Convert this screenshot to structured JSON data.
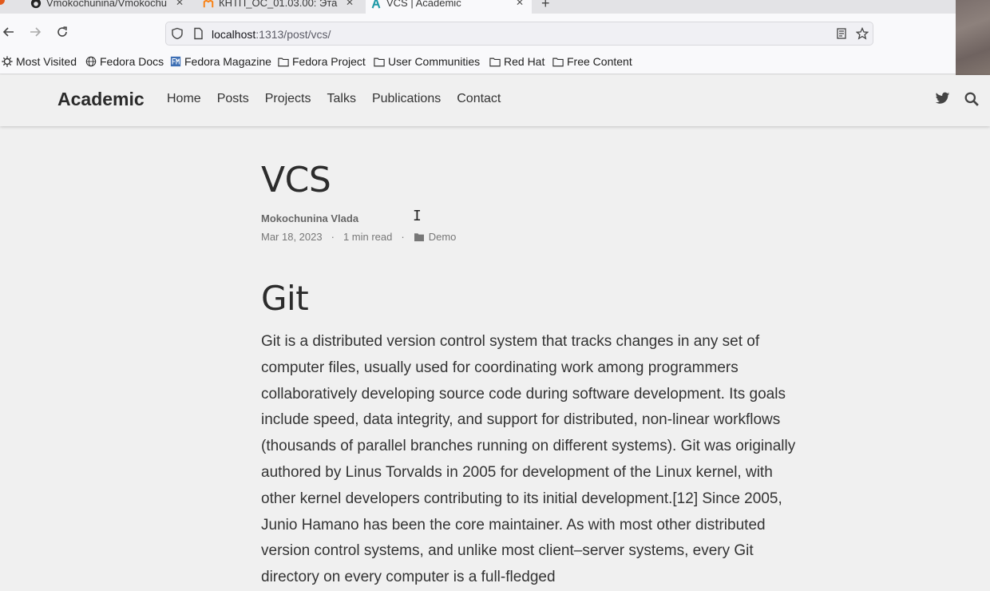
{
  "browser": {
    "tabs": [
      {
        "label": "Vmokochunina/Vmokochu",
        "icon": "github-icon",
        "active": false
      },
      {
        "label": "КНТП_ОС_01.03.00: Эта",
        "icon": "moodle-icon",
        "active": false
      },
      {
        "label": "VCS | Academic",
        "icon": "academic-icon",
        "active": true
      }
    ],
    "new_tab_label": "+",
    "url_host": "localhost",
    "url_path": ":1313/post/vcs/",
    "bookmarks": [
      {
        "label": "Most Visited",
        "icon": "gear-icon"
      },
      {
        "label": "Fedora Docs",
        "icon": "globe-icon"
      },
      {
        "label": "Fedora Magazine",
        "icon": "fedora-magazine-icon"
      },
      {
        "label": "Fedora Project",
        "icon": "folder-icon"
      },
      {
        "label": "User Communities",
        "icon": "folder-icon"
      },
      {
        "label": "Red Hat",
        "icon": "folder-icon"
      },
      {
        "label": "Free Content",
        "icon": "folder-icon"
      }
    ]
  },
  "site": {
    "brand": "Academic",
    "menu": [
      "Home",
      "Posts",
      "Projects",
      "Talks",
      "Publications",
      "Contact"
    ]
  },
  "article": {
    "title": "VCS",
    "author": "Mokochunina Vlada",
    "date": "Mar 18, 2023",
    "sep": "·",
    "read_time": "1 min read",
    "category": "Demo",
    "heading": "Git",
    "paragraph": "Git is a distributed version control system that tracks changes in any set of computer files, usually used for coordinating work among programmers collaboratively developing source code during software development. Its goals include speed, data integrity, and support for distributed, non-linear workflows (thousands of parallel branches running on different systems). Git was originally authored by Linus Torvalds in 2005 for development of the Linux kernel, with other kernel developers contributing to its initial development.[12] Since 2005, Junio Hamano has been the core maintainer. As with most other distributed version control systems, and unlike most client–server systems, every Git directory on every computer is a full-fledged"
  },
  "colors": {
    "accent": "#2b2b2b",
    "page_bg": "#f0f0f0"
  }
}
